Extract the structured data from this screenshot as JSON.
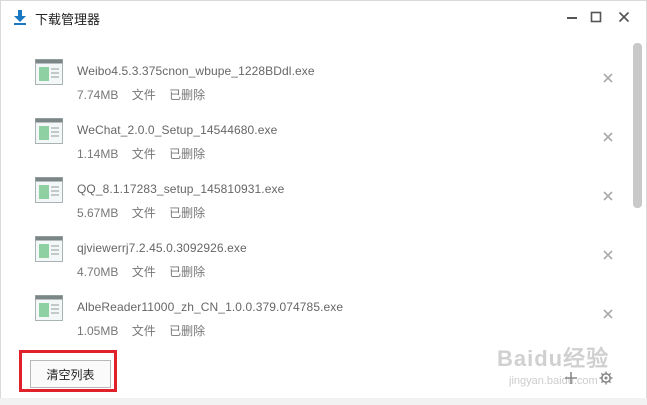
{
  "window": {
    "title": "下载管理器"
  },
  "downloads": [
    {
      "name": "Weibo4.5.3.375cnon_wbupe_1228BDdl.exe",
      "size": "7.74MB",
      "type": "文件",
      "status": "已删除"
    },
    {
      "name": "WeChat_2.0.0_Setup_14544680.exe",
      "size": "1.14MB",
      "type": "文件",
      "status": "已删除"
    },
    {
      "name": "QQ_8.1.17283_setup_145810931.exe",
      "size": "5.67MB",
      "type": "文件",
      "status": "已删除"
    },
    {
      "name": "qjviewerrj7.2.45.0.3092926.exe",
      "size": "4.70MB",
      "type": "文件",
      "status": "已删除"
    },
    {
      "name": "AlbeReader11000_zh_CN_1.0.0.379.074785.exe",
      "size": "1.05MB",
      "type": "文件",
      "status": "已删除"
    }
  ],
  "footer": {
    "clear_label": "清空列表"
  },
  "watermark": {
    "main": "Baidu经验",
    "sub": "jingyan.baidu.com"
  },
  "colors": {
    "accent": "#1a78c2",
    "highlight": "#e0202a"
  },
  "icons": {
    "title": "download-arrow-icon",
    "file": "exe-file-icon",
    "remove": "close-x-icon",
    "add": "plus-icon",
    "settings": "gear-icon"
  }
}
